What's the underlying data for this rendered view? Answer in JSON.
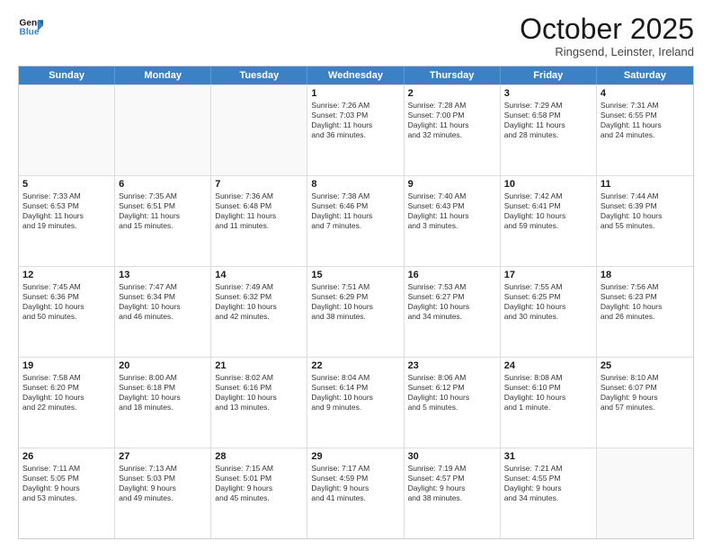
{
  "logo": {
    "line1": "General",
    "line2": "Blue"
  },
  "title": "October 2025",
  "subtitle": "Ringsend, Leinster, Ireland",
  "days_header": [
    "Sunday",
    "Monday",
    "Tuesday",
    "Wednesday",
    "Thursday",
    "Friday",
    "Saturday"
  ],
  "rows": [
    [
      {
        "day": "",
        "empty": true
      },
      {
        "day": "",
        "empty": true
      },
      {
        "day": "",
        "empty": true
      },
      {
        "day": "1",
        "lines": [
          "Sunrise: 7:26 AM",
          "Sunset: 7:03 PM",
          "Daylight: 11 hours",
          "and 36 minutes."
        ]
      },
      {
        "day": "2",
        "lines": [
          "Sunrise: 7:28 AM",
          "Sunset: 7:00 PM",
          "Daylight: 11 hours",
          "and 32 minutes."
        ]
      },
      {
        "day": "3",
        "lines": [
          "Sunrise: 7:29 AM",
          "Sunset: 6:58 PM",
          "Daylight: 11 hours",
          "and 28 minutes."
        ]
      },
      {
        "day": "4",
        "lines": [
          "Sunrise: 7:31 AM",
          "Sunset: 6:55 PM",
          "Daylight: 11 hours",
          "and 24 minutes."
        ]
      }
    ],
    [
      {
        "day": "5",
        "lines": [
          "Sunrise: 7:33 AM",
          "Sunset: 6:53 PM",
          "Daylight: 11 hours",
          "and 19 minutes."
        ]
      },
      {
        "day": "6",
        "lines": [
          "Sunrise: 7:35 AM",
          "Sunset: 6:51 PM",
          "Daylight: 11 hours",
          "and 15 minutes."
        ]
      },
      {
        "day": "7",
        "lines": [
          "Sunrise: 7:36 AM",
          "Sunset: 6:48 PM",
          "Daylight: 11 hours",
          "and 11 minutes."
        ]
      },
      {
        "day": "8",
        "lines": [
          "Sunrise: 7:38 AM",
          "Sunset: 6:46 PM",
          "Daylight: 11 hours",
          "and 7 minutes."
        ]
      },
      {
        "day": "9",
        "lines": [
          "Sunrise: 7:40 AM",
          "Sunset: 6:43 PM",
          "Daylight: 11 hours",
          "and 3 minutes."
        ]
      },
      {
        "day": "10",
        "lines": [
          "Sunrise: 7:42 AM",
          "Sunset: 6:41 PM",
          "Daylight: 10 hours",
          "and 59 minutes."
        ]
      },
      {
        "day": "11",
        "lines": [
          "Sunrise: 7:44 AM",
          "Sunset: 6:39 PM",
          "Daylight: 10 hours",
          "and 55 minutes."
        ]
      }
    ],
    [
      {
        "day": "12",
        "lines": [
          "Sunrise: 7:45 AM",
          "Sunset: 6:36 PM",
          "Daylight: 10 hours",
          "and 50 minutes."
        ]
      },
      {
        "day": "13",
        "lines": [
          "Sunrise: 7:47 AM",
          "Sunset: 6:34 PM",
          "Daylight: 10 hours",
          "and 46 minutes."
        ]
      },
      {
        "day": "14",
        "lines": [
          "Sunrise: 7:49 AM",
          "Sunset: 6:32 PM",
          "Daylight: 10 hours",
          "and 42 minutes."
        ]
      },
      {
        "day": "15",
        "lines": [
          "Sunrise: 7:51 AM",
          "Sunset: 6:29 PM",
          "Daylight: 10 hours",
          "and 38 minutes."
        ]
      },
      {
        "day": "16",
        "lines": [
          "Sunrise: 7:53 AM",
          "Sunset: 6:27 PM",
          "Daylight: 10 hours",
          "and 34 minutes."
        ]
      },
      {
        "day": "17",
        "lines": [
          "Sunrise: 7:55 AM",
          "Sunset: 6:25 PM",
          "Daylight: 10 hours",
          "and 30 minutes."
        ]
      },
      {
        "day": "18",
        "lines": [
          "Sunrise: 7:56 AM",
          "Sunset: 6:23 PM",
          "Daylight: 10 hours",
          "and 26 minutes."
        ]
      }
    ],
    [
      {
        "day": "19",
        "lines": [
          "Sunrise: 7:58 AM",
          "Sunset: 6:20 PM",
          "Daylight: 10 hours",
          "and 22 minutes."
        ]
      },
      {
        "day": "20",
        "lines": [
          "Sunrise: 8:00 AM",
          "Sunset: 6:18 PM",
          "Daylight: 10 hours",
          "and 18 minutes."
        ]
      },
      {
        "day": "21",
        "lines": [
          "Sunrise: 8:02 AM",
          "Sunset: 6:16 PM",
          "Daylight: 10 hours",
          "and 13 minutes."
        ]
      },
      {
        "day": "22",
        "lines": [
          "Sunrise: 8:04 AM",
          "Sunset: 6:14 PM",
          "Daylight: 10 hours",
          "and 9 minutes."
        ]
      },
      {
        "day": "23",
        "lines": [
          "Sunrise: 8:06 AM",
          "Sunset: 6:12 PM",
          "Daylight: 10 hours",
          "and 5 minutes."
        ]
      },
      {
        "day": "24",
        "lines": [
          "Sunrise: 8:08 AM",
          "Sunset: 6:10 PM",
          "Daylight: 10 hours",
          "and 1 minute."
        ]
      },
      {
        "day": "25",
        "lines": [
          "Sunrise: 8:10 AM",
          "Sunset: 6:07 PM",
          "Daylight: 9 hours",
          "and 57 minutes."
        ]
      }
    ],
    [
      {
        "day": "26",
        "lines": [
          "Sunrise: 7:11 AM",
          "Sunset: 5:05 PM",
          "Daylight: 9 hours",
          "and 53 minutes."
        ]
      },
      {
        "day": "27",
        "lines": [
          "Sunrise: 7:13 AM",
          "Sunset: 5:03 PM",
          "Daylight: 9 hours",
          "and 49 minutes."
        ]
      },
      {
        "day": "28",
        "lines": [
          "Sunrise: 7:15 AM",
          "Sunset: 5:01 PM",
          "Daylight: 9 hours",
          "and 45 minutes."
        ]
      },
      {
        "day": "29",
        "lines": [
          "Sunrise: 7:17 AM",
          "Sunset: 4:59 PM",
          "Daylight: 9 hours",
          "and 41 minutes."
        ]
      },
      {
        "day": "30",
        "lines": [
          "Sunrise: 7:19 AM",
          "Sunset: 4:57 PM",
          "Daylight: 9 hours",
          "and 38 minutes."
        ]
      },
      {
        "day": "31",
        "lines": [
          "Sunrise: 7:21 AM",
          "Sunset: 4:55 PM",
          "Daylight: 9 hours",
          "and 34 minutes."
        ]
      },
      {
        "day": "",
        "empty": true
      }
    ]
  ]
}
